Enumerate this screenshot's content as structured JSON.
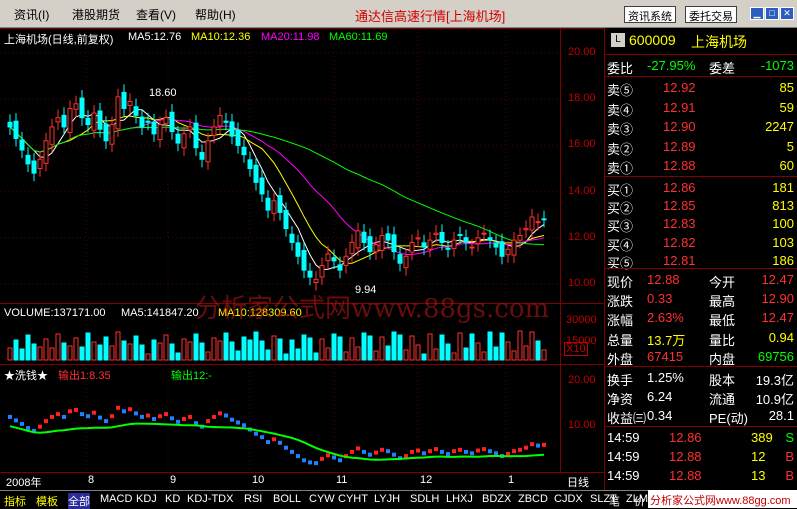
{
  "menu": {
    "items": [
      "资讯(I)",
      "港股期货",
      "查看(V)",
      "帮助(H)"
    ]
  },
  "app_title": "通达信高速行情[上海机场]",
  "top_buttons": [
    "资讯系统",
    "委托交易"
  ],
  "chart": {
    "header": "上海机场(日线,前复权)",
    "ma": [
      {
        "label": "MA5:12.76",
        "color": "#ffffff"
      },
      {
        "label": "MA10:12.36",
        "color": "#ffff00"
      },
      {
        "label": "MA20:11.98",
        "color": "#ff00ff"
      },
      {
        "label": "MA60:11.69",
        "color": "#00ff00"
      }
    ],
    "price_axis": [
      "20.00",
      "18.00",
      "16.00",
      "14.00",
      "12.00",
      "10.00"
    ],
    "high_label": "18.60",
    "low_label": "9.94",
    "volume_header": "VOLUME:137171.00",
    "vol_ma": [
      {
        "label": "MA5:141847.20",
        "color": "#ffffff"
      },
      {
        "label": "MA10:128309.60",
        "color": "#ffff00"
      }
    ],
    "volume_axis": [
      "30000",
      "15000"
    ],
    "volume_unit": "X10",
    "indicator_name": "★洗钱★",
    "indicator_out1": "输出1:8.35",
    "indicator_out2": "输出12:-",
    "indicator_axis": [
      "20.00",
      "10.00"
    ],
    "months": [
      "2008年",
      "8",
      "9",
      "10",
      "11",
      "12",
      "1"
    ],
    "period": "日线"
  },
  "chart_data": {
    "type": "candlestick",
    "title": "上海机场(日线,前复权)",
    "ylim": [
      9.5,
      20.5
    ],
    "series_ma": {
      "MA5": 12.76,
      "MA10": 12.36,
      "MA20": 11.98,
      "MA60": 11.69
    },
    "closes": [
      16.8,
      16.3,
      15.8,
      15.2,
      14.8,
      15.4,
      16.2,
      16.8,
      17.2,
      16.8,
      17.6,
      17.8,
      17.2,
      16.9,
      17.4,
      16.7,
      16.2,
      16.9,
      18.1,
      17.6,
      17.9,
      17.3,
      16.8,
      17.0,
      16.5,
      16.9,
      17.2,
      16.6,
      16.1,
      16.5,
      16.8,
      15.9,
      15.4,
      16.2,
      16.8,
      17.3,
      17.0,
      16.4,
      16.0,
      15.6,
      15.0,
      14.4,
      13.9,
      13.2,
      13.6,
      13.1,
      12.4,
      11.8,
      11.2,
      10.6,
      10.3,
      10.2,
      10.8,
      11.3,
      11.0,
      10.6,
      11.2,
      11.8,
      12.3,
      11.8,
      11.4,
      11.7,
      12.1,
      11.9,
      11.4,
      10.9,
      11.2,
      11.8,
      12.0,
      11.6,
      11.9,
      12.2,
      11.8,
      11.5,
      11.9,
      12.1,
      11.8,
      11.6,
      12.0,
      12.2,
      11.9,
      11.6,
      11.2,
      11.5,
      11.9,
      12.1,
      12.4,
      12.9,
      12.7,
      12.8
    ]
  },
  "quote": {
    "code": "600009",
    "name": "上海机场",
    "webi_label": "委比",
    "webi": "-27.95%",
    "weicha_label": "委差",
    "weicha": "-1073",
    "asks": [
      {
        "label": "卖⑤",
        "price": "12.92",
        "vol": "85"
      },
      {
        "label": "卖④",
        "price": "12.91",
        "vol": "59"
      },
      {
        "label": "卖③",
        "price": "12.90",
        "vol": "2247"
      },
      {
        "label": "卖②",
        "price": "12.89",
        "vol": "5"
      },
      {
        "label": "卖①",
        "price": "12.88",
        "vol": "60"
      }
    ],
    "bids": [
      {
        "label": "买①",
        "price": "12.86",
        "vol": "181"
      },
      {
        "label": "买②",
        "price": "12.85",
        "vol": "813"
      },
      {
        "label": "买③",
        "price": "12.83",
        "vol": "100"
      },
      {
        "label": "买④",
        "price": "12.82",
        "vol": "103"
      },
      {
        "label": "买⑤",
        "price": "12.81",
        "vol": "186"
      }
    ],
    "stats1": [
      {
        "l1": "现价",
        "v1": "12.88",
        "l2": "今开",
        "v2": "12.47"
      },
      {
        "l1": "涨跌",
        "v1": "0.33",
        "l2": "最高",
        "v2": "12.90"
      },
      {
        "l1": "涨幅",
        "v1": "2.63%",
        "l2": "最低",
        "v2": "12.47"
      },
      {
        "l1": "总量",
        "v1": "13.7万",
        "l2": "量比",
        "v2": "0.94"
      },
      {
        "l1": "外盘",
        "v1": "67415",
        "l2": "内盘",
        "v2": "69756"
      }
    ],
    "stats2": [
      {
        "l1": "换手",
        "v1": "1.25%",
        "l2": "股本",
        "v2": "19.3亿"
      },
      {
        "l1": "净资",
        "v1": "6.24",
        "l2": "流通",
        "v2": "10.9亿"
      },
      {
        "l1": "收益㈢",
        "v1": "0.34",
        "l2": "PE(动)",
        "v2": "28.1"
      }
    ],
    "ticks": [
      {
        "time": "14:59",
        "price": "12.86",
        "vol": "389",
        "dir": "S"
      },
      {
        "time": "14:59",
        "price": "12.88",
        "vol": "12",
        "dir": "B"
      },
      {
        "time": "14:59",
        "price": "12.88",
        "vol": "13",
        "dir": "B"
      }
    ]
  },
  "tabs": [
    "指标",
    "模板",
    "全部",
    "MACD",
    "KDJ",
    "KD",
    "KDJ-TDX",
    "RSI",
    "BOLL",
    "CYW",
    "CYHT",
    "LYJH",
    "SDLH",
    "LHXJ",
    "BDZX",
    "ZBCD",
    "CJDX",
    "SLZT",
    "ZLMM"
  ],
  "bottom_right": [
    "笔",
    "价"
  ],
  "watermark": "分析家公式网www.88gs.com",
  "footer_site": "分析家公式网www.88gg.com"
}
